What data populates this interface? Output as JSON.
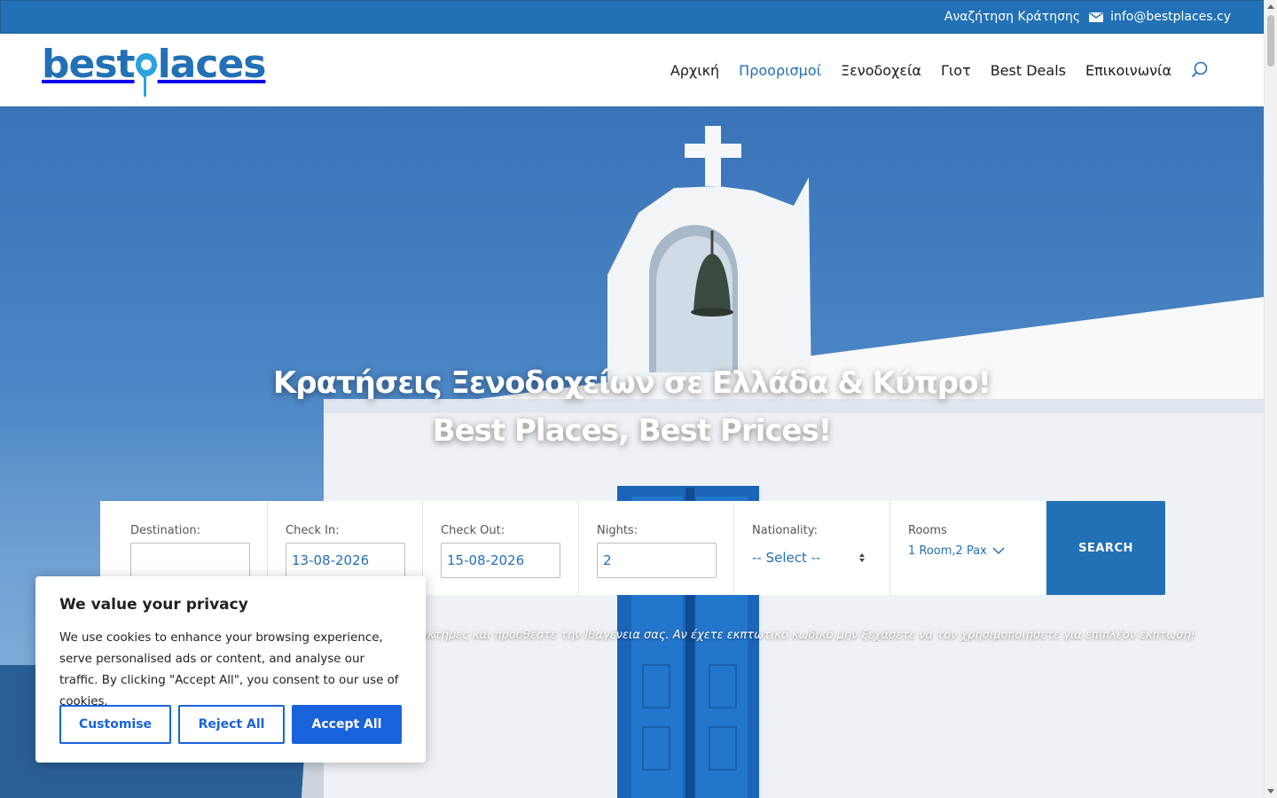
{
  "topbar": {
    "search_booking": "Αναζήτηση Κράτησης",
    "email": "info@bestplaces.cy"
  },
  "logo": {
    "part1": "best",
    "part2": "laces"
  },
  "nav": {
    "items": [
      {
        "label": "Αρχική",
        "active": false
      },
      {
        "label": "Προορισμοί",
        "active": true
      },
      {
        "label": "Ξενοδοχεία",
        "active": false
      },
      {
        "label": "Γιοτ",
        "active": false
      },
      {
        "label": "Best Deals",
        "active": false
      },
      {
        "label": "Επικοινωνία",
        "active": false
      }
    ],
    "search_icon": "search-icon"
  },
  "hero": {
    "title_line1": "Κρατήσεις Ξενοδοχείων σε Ελλάδα & Κύπρο!",
    "title_line2": "Best Places, Best Prices!",
    "hint": "ούς Χαρακτήρες και προσθέστε την Ιθαγένεια σας. Αν έχετε εκπτωτικό κωδικό μην ξεχάσετε να τον χρησιμοποιήσετε για επιπλέον έκπτωση!"
  },
  "search": {
    "destination_label": "Destination:",
    "destination_value": "",
    "checkin_label": "Check In:",
    "checkin_value": "13-08-2026",
    "checkout_label": "Check Out:",
    "checkout_value": "15-08-2026",
    "nights_label": "Nights:",
    "nights_value": "2",
    "nationality_label": "Nationality:",
    "nationality_value": "-- Select --",
    "rooms_label": "Rooms",
    "rooms_value": "1 Room,2 Pax",
    "button_label": "SEARCH"
  },
  "cookie": {
    "title": "We value your privacy",
    "text": "We use cookies to enhance your browsing experience, serve personalised ads or content, and analyse our traffic. By clicking \"Accept All\", you consent to our use of cookies.",
    "customise": "Customise",
    "reject": "Reject All",
    "accept": "Accept All"
  },
  "colors": {
    "brand_blue": "#2270b5",
    "brand_light_blue": "#2aa3e0",
    "cookie_accent": "#1863dc"
  }
}
